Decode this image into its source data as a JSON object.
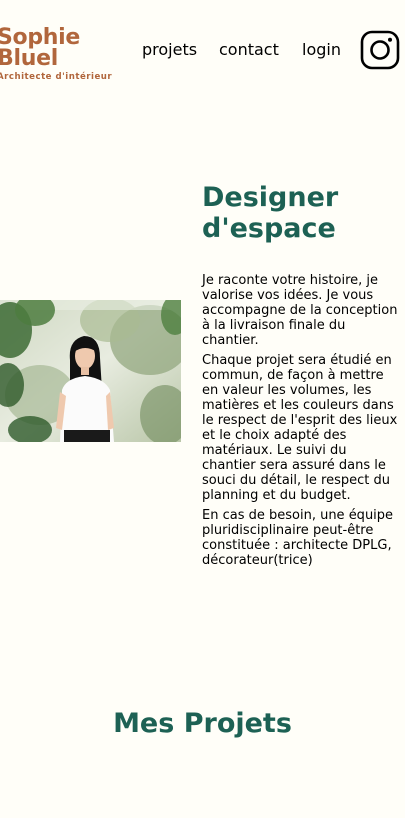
{
  "header": {
    "logo_name": "Sophie Bluel",
    "logo_tagline": "Architecte d'intérieur",
    "nav": {
      "projets": "projets",
      "contact": "contact",
      "login": "login"
    },
    "instagram_icon": "instagram-icon"
  },
  "intro": {
    "title": "Designer d'espace",
    "photo_icon": "portrait-photo",
    "paragraph_1_lines": [
      "Je raconte votre histoire, je",
      "valorise vos idées. Je vous",
      "accompagne de la conception",
      "à la livraison finale du",
      "chantier."
    ],
    "paragraph_2_lines": [
      "Chaque projet sera étudié en",
      "commun, de façon à mettre",
      "en valeur les volumes, les",
      "matières et les couleurs dans",
      "le respect de l'esprit des lieux",
      "et le choix adapté des",
      "matériaux. Le suivi du",
      "chantier sera assuré dans le",
      "souci du détail, le respect du",
      "planning et du budget."
    ],
    "paragraph_3_lines": [
      "En cas de besoin, une équipe",
      "pluridisciplinaire peut-être",
      "constituée : architecte DPLG,",
      "décorateur(trice)"
    ]
  },
  "projects": {
    "title": "Mes Projets"
  },
  "colors": {
    "background": "#FFFEF8",
    "logo": "#B1663C",
    "title": "#1D6154"
  }
}
